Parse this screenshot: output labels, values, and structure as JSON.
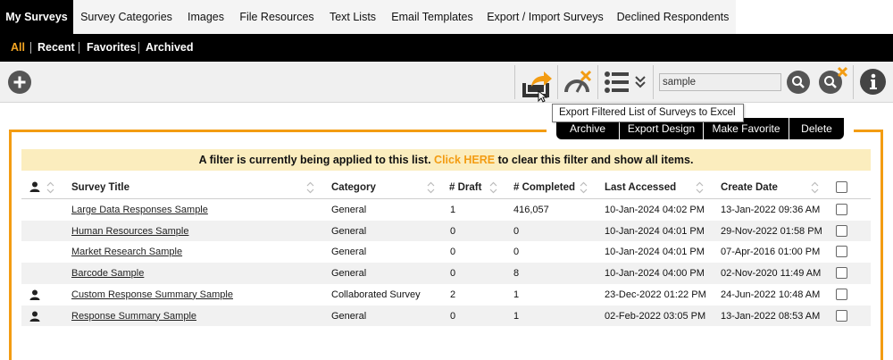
{
  "top_tabs": [
    {
      "label": "My Surveys",
      "active": true
    },
    {
      "label": "Survey Categories"
    },
    {
      "label": "Images"
    },
    {
      "label": "File Resources"
    },
    {
      "label": "Text Lists"
    },
    {
      "label": "Email Templates"
    },
    {
      "label": "Export / Import Surveys"
    },
    {
      "label": "Declined Respondents"
    }
  ],
  "sub_nav": [
    {
      "label": "All",
      "active": true
    },
    {
      "label": "Recent"
    },
    {
      "label": "Favorites"
    },
    {
      "label": "Archived"
    }
  ],
  "toolbar": {
    "search_value": "sample",
    "icons": [
      "add-icon",
      "export-excel-icon",
      "speedometer-clear-icon",
      "list-view-icon",
      "chevron-down-icon",
      "search-icon",
      "clear-search-icon",
      "info-icon"
    ]
  },
  "tooltip": "Export Filtered List of Surveys to Excel",
  "actions": {
    "archive": "Archive",
    "export_design": "Export Design",
    "make_favorite": "Make Favorite",
    "delete": "Delete"
  },
  "banner": {
    "prefix": "A filter is currently being applied to this list.",
    "link": "Click HERE",
    "suffix": "to clear this filter and show all items."
  },
  "table": {
    "headers": {
      "title": "Survey Title",
      "category": "Category",
      "draft": "# Draft",
      "completed": "# Completed",
      "last_accessed": "Last Accessed",
      "create_date": "Create Date"
    },
    "rows": [
      {
        "collab": false,
        "title": "Large Data Responses Sample",
        "category": "General",
        "draft": "1",
        "completed": "416,057",
        "last_accessed": "10-Jan-2024 04:02 PM",
        "create_date": "13-Jan-2022 09:36 AM"
      },
      {
        "collab": false,
        "title": "Human Resources Sample",
        "category": "General",
        "draft": "0",
        "completed": "0",
        "last_accessed": "10-Jan-2024 04:01 PM",
        "create_date": "29-Nov-2022 01:58 PM"
      },
      {
        "collab": false,
        "title": "Market Research Sample",
        "category": "General",
        "draft": "0",
        "completed": "0",
        "last_accessed": "10-Jan-2024 04:01 PM",
        "create_date": "07-Apr-2016 01:00 PM"
      },
      {
        "collab": false,
        "title": "Barcode Sample",
        "category": "General",
        "draft": "0",
        "completed": "8",
        "last_accessed": "10-Jan-2024 04:00 PM",
        "create_date": "02-Nov-2020 11:49 AM"
      },
      {
        "collab": true,
        "title": "Custom Response Summary Sample",
        "category": "Collaborated Survey",
        "draft": "2",
        "completed": "1",
        "last_accessed": "23-Dec-2022 01:22 PM",
        "create_date": "24-Jun-2022 10:48 AM"
      },
      {
        "collab": true,
        "title": "Response Summary Sample",
        "category": "General",
        "draft": "0",
        "completed": "1",
        "last_accessed": "02-Feb-2022 03:05 PM",
        "create_date": "13-Jan-2022 08:53 AM"
      }
    ]
  },
  "colors": {
    "accent": "#f39c12",
    "banner_bg": "#fbedbe",
    "nav_bg": "#000000"
  }
}
